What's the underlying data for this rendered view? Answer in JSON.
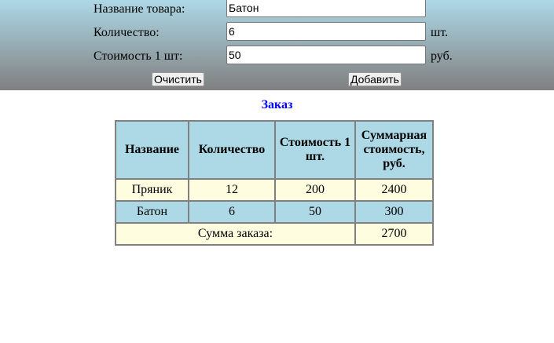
{
  "form": {
    "name_label": "Название товара:",
    "name_value": "Батон",
    "qty_label": "Количество:",
    "qty_value": "6",
    "qty_unit": "шт.",
    "price_label": "Стоимость 1 шт:",
    "price_value": "50",
    "price_unit": "руб.",
    "clear_label": "Очистить",
    "add_label": "Добавить"
  },
  "order": {
    "title": "Заказ",
    "headers": [
      "Название",
      "Количество",
      "Стоимость 1 шт.",
      "Суммарная стоимость, руб."
    ],
    "rows": [
      [
        "Пряник",
        "12",
        "200",
        "2400"
      ],
      [
        "Батон",
        "6",
        "50",
        "300"
      ]
    ],
    "total_label": "Сумма заказа:",
    "total_value": "2700"
  }
}
